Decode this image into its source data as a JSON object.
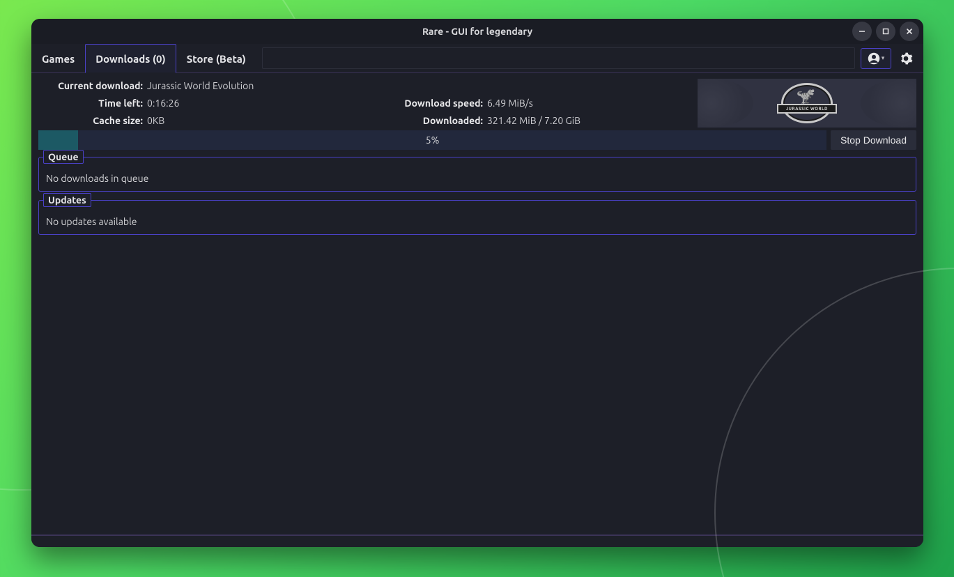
{
  "window": {
    "title": "Rare - GUI for legendary"
  },
  "tabs": {
    "games": "Games",
    "downloads": "Downloads (0)",
    "store": "Store (Beta)",
    "active": "downloads"
  },
  "download": {
    "labels": {
      "current": "Current download:",
      "time_left": "Time left:",
      "cache_size": "Cache size:",
      "speed": "Download speed:",
      "downloaded": "Downloaded:"
    },
    "game_name": "Jurassic World Evolution",
    "time_left": "0:16:26",
    "cache_size": "0KB",
    "speed": "6.49 MiB/s",
    "downloaded": "321.42 MiB / 7.20 GiB",
    "progress_percent": 5,
    "progress_label": "5%",
    "stop_label": "Stop Download",
    "logo_text": "JURASSIC WORLD"
  },
  "queue": {
    "title": "Queue",
    "empty_text": "No downloads in queue"
  },
  "updates": {
    "title": "Updates",
    "empty_text": "No updates available"
  }
}
